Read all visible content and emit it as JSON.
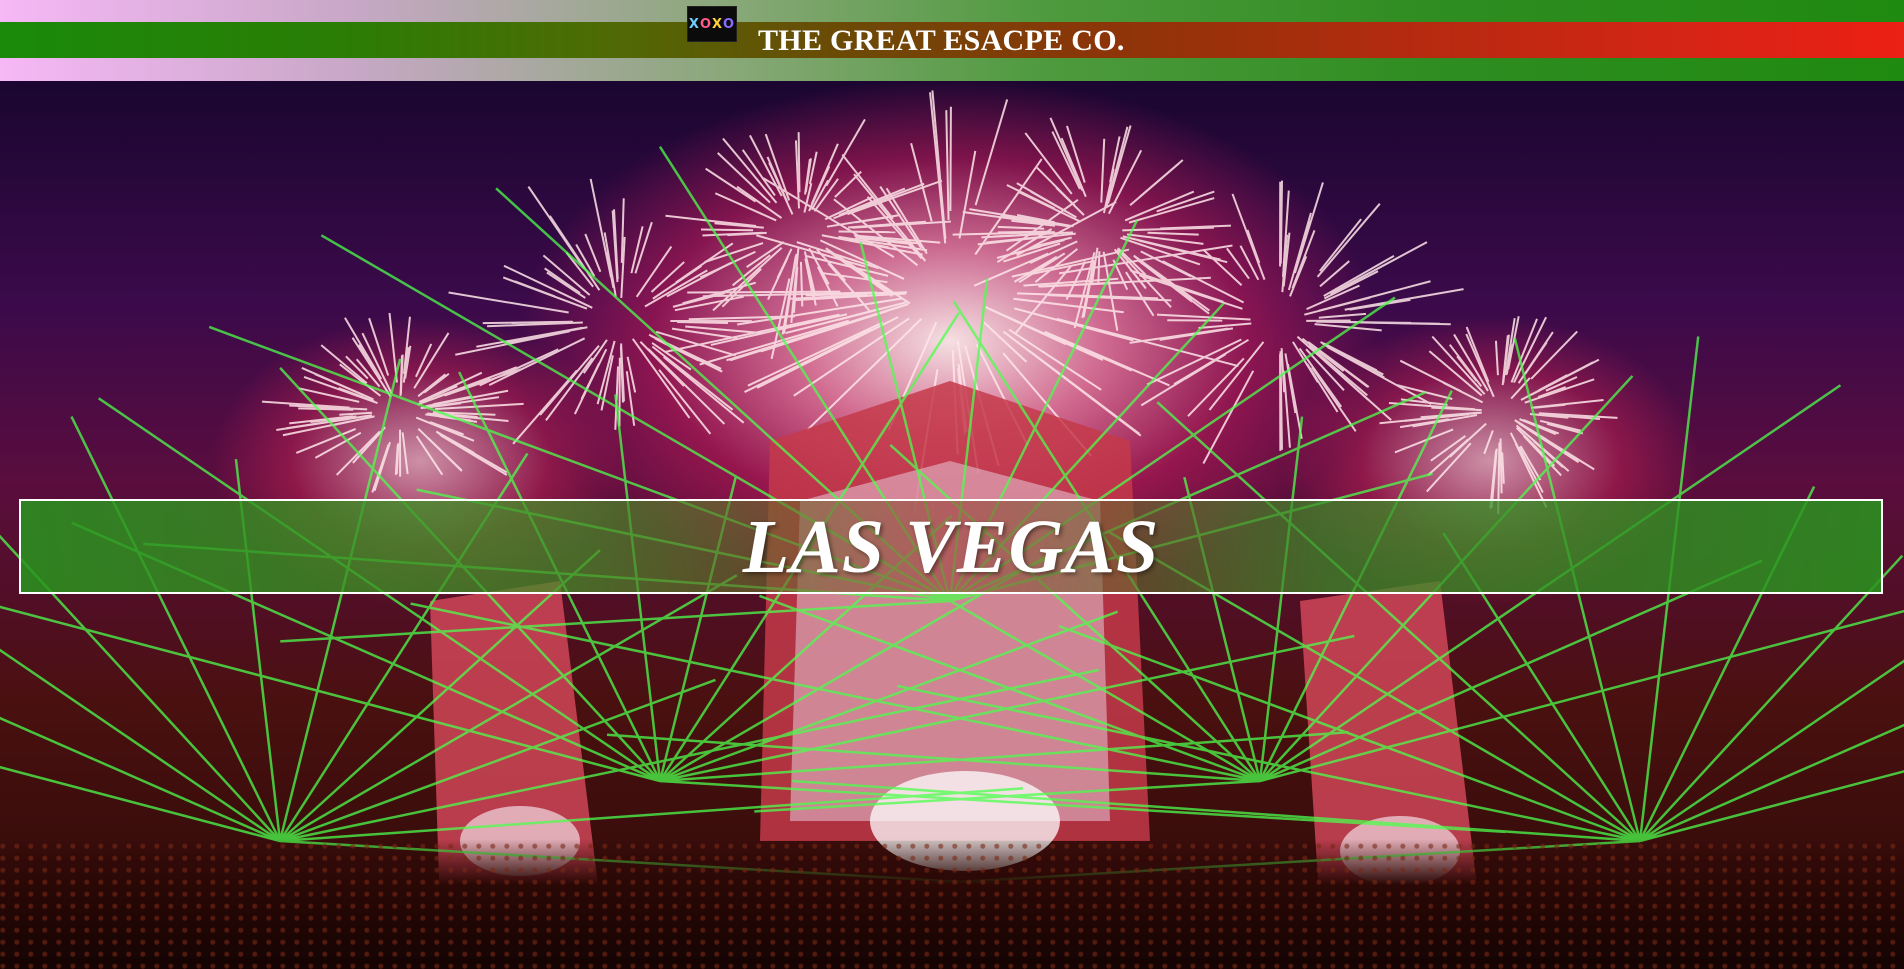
{
  "header": {
    "logo_text": "XOXO",
    "title": "THE GREAT ESACPE CO."
  },
  "hero": {
    "title": "LAS VEGAS"
  }
}
